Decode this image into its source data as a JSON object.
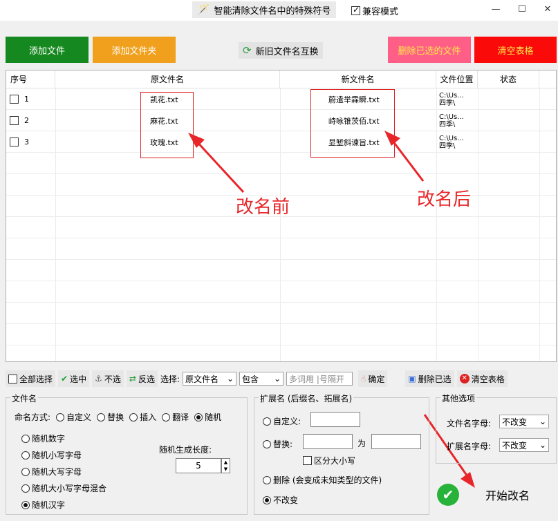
{
  "window": {
    "title": "智能清除文件名中的特殊符号",
    "compat_label": "兼容模式",
    "compat_checked": true,
    "min_icon": "minimize-icon",
    "max_icon": "maximize-icon",
    "close_icon": "close-icon"
  },
  "toolbar": {
    "add_file": "添加文件",
    "add_folder": "添加文件夹",
    "swap_names": "新旧文件名互换",
    "delete_selected": "删除已选的文件",
    "clear_table": "清空表格"
  },
  "colors": {
    "add_file": "#15891f",
    "add_folder": "#f0a01c",
    "delete_selected": "#ff5f87",
    "clear_table": "#fb0a0a",
    "annotation_red": "#e8262a"
  },
  "table": {
    "headers": [
      "序号",
      "原文件名",
      "新文件名",
      "文件位置",
      "状态"
    ],
    "rows": [
      {
        "index": "1",
        "old": "凯花.txt",
        "new": "蔚遣举霖瞬.txt",
        "loc1": "C:\\Us...",
        "loc2": "四季\\",
        "status": ""
      },
      {
        "index": "2",
        "old": "麻花.txt",
        "new": "峙咏锥茨佰.txt",
        "loc1": "C:\\Us...",
        "loc2": "四季\\",
        "status": ""
      },
      {
        "index": "3",
        "old": "玫瑰.txt",
        "new": "显堑斜谏旨.txt",
        "loc1": "C:\\Us...",
        "loc2": "四季\\",
        "status": ""
      }
    ],
    "annotation_before": "改名前",
    "annotation_after": "改名后"
  },
  "selection_bar": {
    "select_all": "全部选择",
    "select": "选中",
    "deselect": "不选",
    "invert": "反选",
    "choose_label": "选择:",
    "field_value": "原文件名",
    "match_value": "包含",
    "keyword_placeholder": "多词用 |号隔开",
    "confirm": "确定",
    "delete_selected": "删除已选",
    "clear_table": "清空表格"
  },
  "filename_group": {
    "title": "文件名",
    "mode_label": "命名方式:",
    "modes": [
      "自定义",
      "替换",
      "插入",
      "翻译",
      "随机"
    ],
    "mode_selected": "随机",
    "random_options": [
      "随机数字",
      "随机小写字母",
      "随机大写字母",
      "随机大小写字母混合",
      "随机汉字"
    ],
    "random_selected": "随机汉字",
    "length_label": "随机生成长度:",
    "length_value": "5"
  },
  "ext_group": {
    "title": "扩展名 (后缀名、拓展名)",
    "custom_label": "自定义:",
    "replace_label": "替换:",
    "replace_to": "为",
    "case_label": "区分大小写",
    "delete_label": "删除 (会变成未知类型的文件)",
    "keep_label": "不改变",
    "selected": "不改变"
  },
  "other_group": {
    "title": "其他选项",
    "filename_case_label": "文件名字母:",
    "filename_case_value": "不改变",
    "ext_case_label": "扩展名字母:",
    "ext_case_value": "不改变"
  },
  "start": {
    "label": "开始改名"
  }
}
